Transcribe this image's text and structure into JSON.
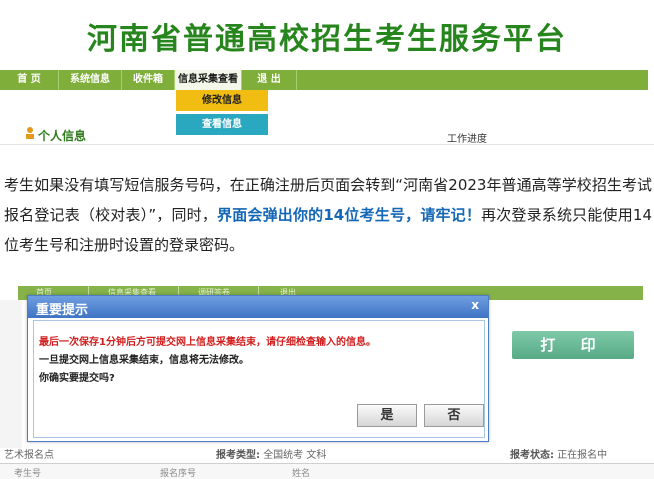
{
  "banner": {
    "title": "河南省普通高校招生考生服务平台"
  },
  "nav": {
    "items": [
      {
        "label": "首    页"
      },
      {
        "label": "系统信息"
      },
      {
        "label": "收件箱"
      },
      {
        "label": "信息采集查看"
      },
      {
        "label": "退    出"
      }
    ]
  },
  "dropdown": {
    "items": [
      {
        "label": "修改信息"
      },
      {
        "label": "查看信息"
      }
    ]
  },
  "personal": {
    "label": "个人信息"
  },
  "workflow": {
    "label": "工作进度"
  },
  "paragraph": {
    "part1": "考生如果没有填写短信服务号码，在正确注册后页面会转到“河南省2023年普通高等学校招生考试报名登记表（校对表）”，同时，",
    "highlight": "界面会弹出你的14位考生号，请牢记！",
    "part2": "再次登录系统只能使用14位考生号和注册时设置的登录密码。"
  },
  "lower_nav": {
    "items": [
      {
        "label": "首页"
      },
      {
        "label": "信息采集查看"
      },
      {
        "label": "调研答卷"
      },
      {
        "label": "退出"
      }
    ]
  },
  "dialog": {
    "title": "重要提示",
    "close": "x",
    "message_warning": "最后一次保存1分钟后方可提交网上信息采集结束，请仔细检查输入的信息。",
    "message_notice": "一旦提交网上信息采集结束，信息将无法修改。",
    "message_confirm": "你确实要提交吗?",
    "yes": "是",
    "no": "否"
  },
  "print": {
    "label": "打 印"
  },
  "info": {
    "art_site": "艺术报名点",
    "exam_type_label": "报考类型:",
    "exam_type_value": "全国统考 文科",
    "status_label": "报考状态:",
    "status_value": "正在报名中"
  },
  "table_header": {
    "c1": "考生号",
    "c2": "报名序号",
    "c3": "姓名"
  },
  "colors": {
    "brand_green": "#27851d",
    "nav_green": "#7fae3a",
    "dialog_blue": "#3f73c4",
    "warning_red": "#d11f1f",
    "highlight_blue": "#1467b6"
  }
}
